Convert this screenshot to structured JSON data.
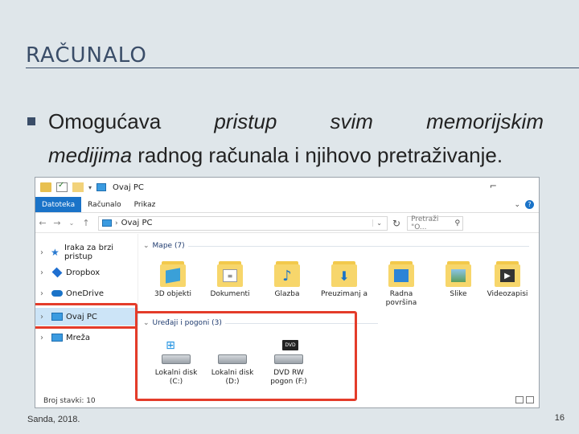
{
  "slide": {
    "title": "RAČUNALO",
    "bullet": {
      "line1": [
        "Omogućava",
        "pristup",
        "svim",
        "memorijskim"
      ],
      "line2_em": "medijima",
      "line2_rest": " radnog računala i njihovo pretraživanje."
    },
    "footer_left": "Sanda, 2018.",
    "page_number": "16"
  },
  "explorer": {
    "window_title": "Ovaj PC",
    "titlebar_separator": "▾",
    "maximize_glyph": "⌐",
    "ribbon_tabs": [
      "Datoteka",
      "Računalo",
      "Prikaz"
    ],
    "ribbon_help": "?",
    "address": "Ovaj PC",
    "search_placeholder": "Pretraži \"O...",
    "sidebar_items": [
      {
        "label": "Iraka za brzi pristup",
        "icon": "star-icon"
      },
      {
        "label": "Dropbox",
        "icon": "dropbox-icon"
      },
      {
        "label": "OneDrive",
        "icon": "onedrive-icon"
      },
      {
        "label": "Ovaj PC",
        "icon": "this-pc-icon",
        "selected": true
      },
      {
        "label": "Mreža",
        "icon": "network-icon"
      }
    ],
    "folders_header": "Mape (7)",
    "folders": [
      {
        "label": "3D objekti",
        "icon": "3d-objects-folder-icon"
      },
      {
        "label": "Dokumenti",
        "icon": "documents-folder-icon"
      },
      {
        "label": "Glazba",
        "icon": "music-folder-icon"
      },
      {
        "label": "Preuzimanj a",
        "icon": "downloads-folder-icon"
      },
      {
        "label": "Radna površina",
        "icon": "desktop-folder-icon"
      },
      {
        "label": "Slike",
        "icon": "pictures-folder-icon"
      },
      {
        "label": "Videozapisi",
        "icon": "videos-folder-icon"
      }
    ],
    "drives_header": "Uređaji i pogoni (3)",
    "drives": [
      {
        "label": "Lokalni disk (C:)",
        "icon": "windows-drive-icon"
      },
      {
        "label": "Lokalni disk (D:)",
        "icon": "hard-drive-icon"
      },
      {
        "label": "DVD RW pogon (F:)",
        "icon": "dvd-drive-icon"
      }
    ],
    "status": "Broj stavki: 10"
  },
  "colors": {
    "slide_background": "#dfe6ea",
    "title_color": "#3a4d68",
    "ribbon_accent": "#1a73c8",
    "highlight_red": "#e43c2a",
    "selection_blue": "#cce4f7"
  }
}
